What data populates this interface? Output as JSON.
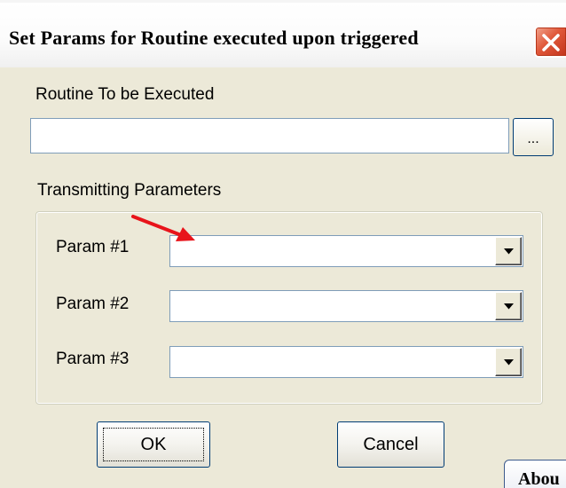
{
  "dialog": {
    "title": "Set Params for Routine executed upon triggered"
  },
  "routine": {
    "label": "Routine To be Executed",
    "value": "",
    "browse_label": "..."
  },
  "params_group": {
    "label": "Transmitting Parameters",
    "params": [
      {
        "label": "Param #1",
        "value": ""
      },
      {
        "label": "Param #2",
        "value": ""
      },
      {
        "label": "Param #3",
        "value": ""
      }
    ]
  },
  "buttons": {
    "ok_label": "OK",
    "cancel_label": "Cancel"
  },
  "background_window": {
    "tab_label": "Abou"
  },
  "annotation": {
    "arrow_color": "#e8141b",
    "arrow_target": "Param #1"
  },
  "colors": {
    "dialog_background": "#ece9d8",
    "close_button": "#e0583a",
    "field_border": "#7f9db9"
  }
}
